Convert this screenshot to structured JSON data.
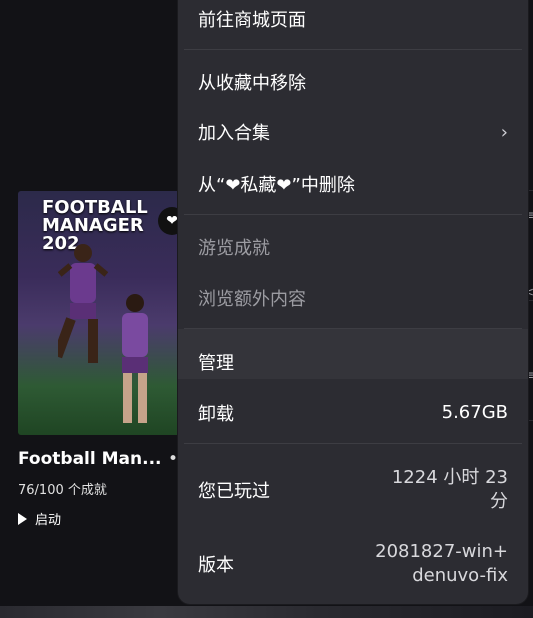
{
  "card": {
    "cover_title": "FOOTBALL\nMANAGER 202",
    "name": "Football Man...",
    "achievements": "76/100 个成就",
    "launch_label": "启动",
    "dot": "•"
  },
  "menu": {
    "store": "前往商城页面",
    "remove_fav": "从收藏中移除",
    "add_collection": "加入合集",
    "remove_private_prefix": "从“",
    "remove_private_heart1": "❤",
    "remove_private_mid": "私藏",
    "remove_private_heart2": "❤",
    "remove_private_suffix": "”中删除",
    "achievements": "游览成就",
    "extra": "浏览额外内容",
    "manage": "管理",
    "uninstall": "卸载",
    "uninstall_size": "5.67GB",
    "played": "您已玩过",
    "played_value_line1": "1224 小时 23",
    "played_value_line2": "分",
    "version": "版本",
    "version_value_line1": "2081827-win+",
    "version_value_line2": "denuvo-fix"
  },
  "colors": {
    "menu_bg": "#2c2c32",
    "page_bg": "#121216",
    "highlight": "#34343a"
  }
}
